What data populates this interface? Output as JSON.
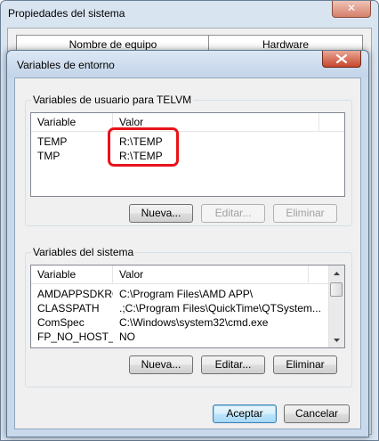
{
  "parent_window": {
    "title": "Propiedades del sistema",
    "close_glyph": "✕",
    "tabs": [
      "Nombre de equipo",
      "Hardware"
    ]
  },
  "dialog": {
    "title": "Variables de entorno",
    "close_icon": "close-icon"
  },
  "user_vars": {
    "group_label": "Variables de usuario para TELVM",
    "columns": [
      "Variable",
      "Valor"
    ],
    "rows": [
      {
        "variable": "TEMP",
        "value": "R:\\TEMP"
      },
      {
        "variable": "TMP",
        "value": "R:\\TEMP"
      }
    ],
    "buttons": {
      "new": "Nueva...",
      "edit": "Editar...",
      "delete": "Eliminar"
    },
    "highlight_color": "#e8131a"
  },
  "system_vars": {
    "group_label": "Variables del sistema",
    "columns": [
      "Variable",
      "Valor"
    ],
    "rows": [
      {
        "variable": "AMDAPPSDKROOT",
        "value": "C:\\Program Files\\AMD APP\\"
      },
      {
        "variable": "CLASSPATH",
        "value": ".;C:\\Program Files\\QuickTime\\QTSystem..."
      },
      {
        "variable": "ComSpec",
        "value": "C:\\Windows\\system32\\cmd.exe"
      },
      {
        "variable": "FP_NO_HOST_C...",
        "value": "NO"
      }
    ],
    "buttons": {
      "new": "Nueva...",
      "edit": "Editar...",
      "delete": "Eliminar"
    }
  },
  "footer": {
    "ok": "Aceptar",
    "cancel": "Cancelar"
  }
}
